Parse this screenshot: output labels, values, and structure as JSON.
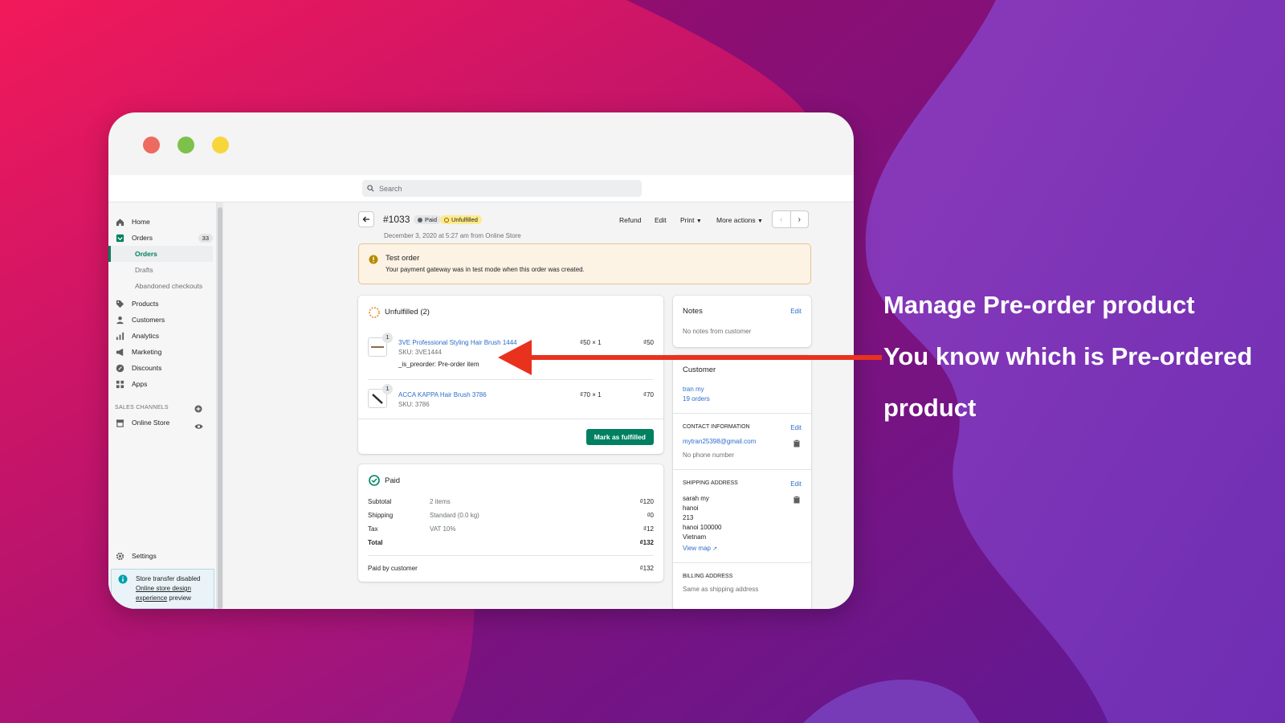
{
  "window_dots": {
    "red": "#ee6a5f",
    "green": "#7cc24a",
    "yellow": "#f8d63b"
  },
  "search": {
    "placeholder": "Search"
  },
  "sidebar": {
    "items": [
      {
        "label": "Home",
        "icon": "home-icon"
      },
      {
        "label": "Orders",
        "icon": "orders-icon",
        "count": "33"
      },
      {
        "label": "Products",
        "icon": "tag-icon"
      },
      {
        "label": "Customers",
        "icon": "person-icon"
      },
      {
        "label": "Analytics",
        "icon": "bar-chart-icon"
      },
      {
        "label": "Marketing",
        "icon": "megaphone-icon"
      },
      {
        "label": "Discounts",
        "icon": "discount-icon"
      },
      {
        "label": "Apps",
        "icon": "apps-icon"
      }
    ],
    "sub_items": [
      "Orders",
      "Drafts",
      "Abandoned checkouts"
    ],
    "sales_channels_label": "SALES CHANNELS",
    "online_store": "Online Store",
    "settings": "Settings",
    "notice": {
      "line1": "Store transfer disabled",
      "line2": "Online store design",
      "line3": "experience",
      "line4": "preview"
    }
  },
  "order": {
    "number": "#1033",
    "paid_badge": "Paid",
    "unfulfilled_badge": "Unfulfilled",
    "date": "December 3, 2020 at 5:27 am from Online Store",
    "actions": {
      "refund": "Refund",
      "edit": "Edit",
      "print": "Print",
      "more": "More actions"
    }
  },
  "test_banner": {
    "title": "Test order",
    "text": "Your payment gateway was in test mode when this order was created."
  },
  "unfulfilled": {
    "title": "Unfulfilled (2)",
    "items": [
      {
        "qty": "1",
        "name": "3VE Professional Styling Hair Brush 1444",
        "sku": "SKU: 3VE1444",
        "prop": "_is_preorder: Pre-order item",
        "unit": "₫50 × 1",
        "total": "₫50"
      },
      {
        "qty": "1",
        "name": "ACCA KAPPA Hair Brush 3786",
        "sku": "SKU: 3786",
        "unit": "₫70 × 1",
        "total": "₫70"
      }
    ],
    "button": "Mark as fulfilled"
  },
  "paid": {
    "title": "Paid",
    "rows": [
      {
        "label": "Subtotal",
        "detail": "2 items",
        "amount": "₫120"
      },
      {
        "label": "Shipping",
        "detail": "Standard (0.0 kg)",
        "amount": "₫0"
      },
      {
        "label": "Tax",
        "detail": "VAT 10%",
        "amount": "₫12"
      },
      {
        "label": "Total",
        "detail": "",
        "amount": "₫132"
      }
    ],
    "paid_by_label": "Paid by customer",
    "paid_by_amount": "₫132"
  },
  "notes": {
    "title": "Notes",
    "edit": "Edit",
    "text": "No notes from customer"
  },
  "customer": {
    "title": "Customer",
    "name": "tran my",
    "orders": "19 orders",
    "contact_title": "CONTACT INFORMATION",
    "contact_edit": "Edit",
    "email": "mytran25398@gmail.com",
    "phone": "No phone number",
    "shipping_title": "SHIPPING ADDRESS",
    "shipping_edit": "Edit",
    "address": [
      "sarah my",
      "hanoi",
      "213",
      "hanoi 100000",
      "Vietnam"
    ],
    "view_map": "View map",
    "billing_title": "BILLING ADDRESS",
    "billing_text": "Same as shipping address"
  },
  "callout": {
    "line1": "Manage Pre-order product",
    "line2": "You know which is Pre-ordered",
    "line3": "product"
  },
  "colors": {
    "accent": "#008060",
    "arrow": "#e8321e",
    "link": "#2c6ecb"
  }
}
